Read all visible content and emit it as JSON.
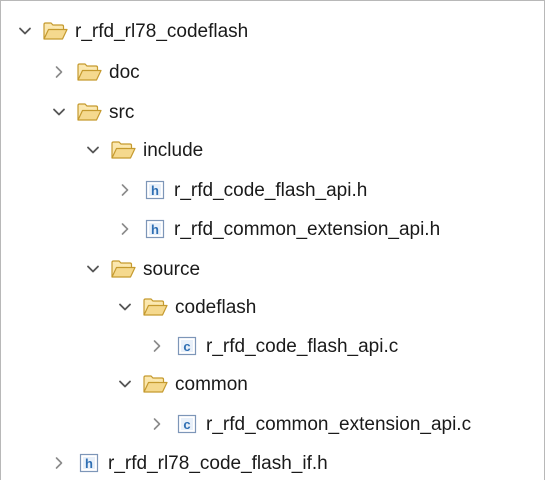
{
  "tree": {
    "root": {
      "label": "r_rfd_rl78_codeflash",
      "expanded": true,
      "icon": "folder-open-icon"
    },
    "doc": {
      "label": "doc",
      "expanded": false,
      "icon": "folder-open-icon"
    },
    "src": {
      "label": "src",
      "expanded": true,
      "icon": "folder-open-icon"
    },
    "include": {
      "label": "include",
      "expanded": true,
      "icon": "folder-open-icon"
    },
    "include_file_1": {
      "label": "r_rfd_code_flash_api.h",
      "expanded": false,
      "icon": "h-file-icon"
    },
    "include_file_2": {
      "label": "r_rfd_common_extension_api.h",
      "expanded": false,
      "icon": "h-file-icon"
    },
    "source": {
      "label": "source",
      "expanded": true,
      "icon": "folder-open-icon"
    },
    "codeflash": {
      "label": "codeflash",
      "expanded": true,
      "icon": "folder-open-icon"
    },
    "codeflash_file": {
      "label": "r_rfd_code_flash_api.c",
      "expanded": false,
      "icon": "c-file-icon"
    },
    "common": {
      "label": "common",
      "expanded": true,
      "icon": "folder-open-icon"
    },
    "common_file": {
      "label": "r_rfd_common_extension_api.c",
      "expanded": false,
      "icon": "c-file-icon"
    },
    "root_file": {
      "label": "r_rfd_rl78_code_flash_if.h",
      "expanded": false,
      "icon": "h-file-icon"
    }
  },
  "colors": {
    "folder_fill": "#f5d98e",
    "folder_stroke": "#c59a2e",
    "file_letter": "#2f6fb3",
    "chevron": "#666666"
  }
}
